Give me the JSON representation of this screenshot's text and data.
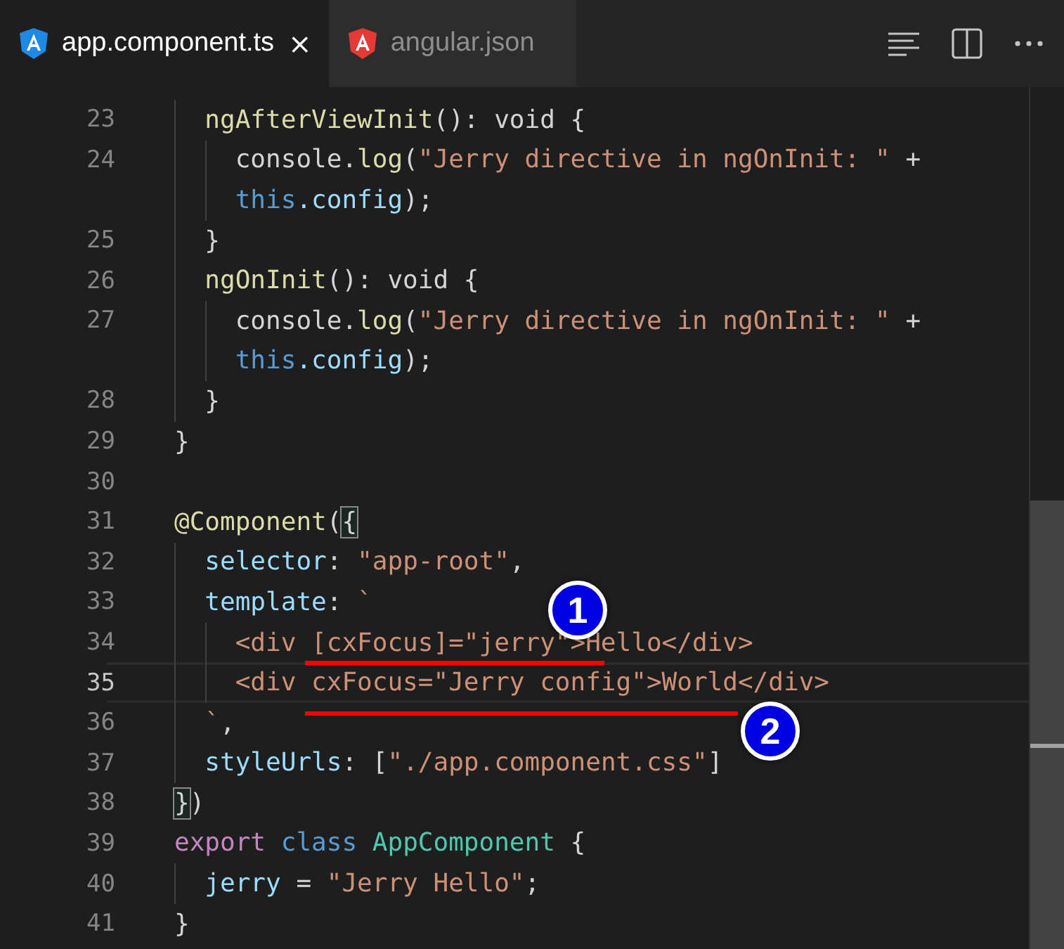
{
  "tabs": [
    {
      "label": "app.component.ts",
      "selected": true,
      "color": "#1e88e5",
      "close": "×"
    },
    {
      "label": "angular.json",
      "selected": false,
      "color": "#e53935"
    }
  ],
  "editor": {
    "lines": [
      {
        "number": "23",
        "current": false,
        "tokens": [
          {
            "t": "  ngAfterViewInit",
            "kind": "fn"
          },
          {
            "t": "(): void {",
            "kind": "plain"
          }
        ]
      },
      {
        "number": "24",
        "current": false,
        "tokens": [
          {
            "t": "    console.",
            "kind": "plain"
          },
          {
            "t": "log",
            "kind": "fn"
          },
          {
            "t": "(",
            "kind": "plain"
          },
          {
            "t": "\"Jerry directive in ngOnInit: \"",
            "kind": "str"
          },
          {
            "t": " +",
            "kind": "plain"
          }
        ]
      },
      {
        "current": false,
        "tokens": [
          {
            "t": "    this",
            "kind": "kw"
          },
          {
            "t": ".config",
            "kind": "prop"
          },
          {
            "t": ");",
            "kind": "plain"
          }
        ]
      },
      {
        "number": "25",
        "current": false,
        "tokens": [
          {
            "t": "  }",
            "kind": "plain"
          }
        ]
      },
      {
        "number": "26",
        "current": false,
        "tokens": [
          {
            "t": "  ngOnInit",
            "kind": "fn"
          },
          {
            "t": "(): void {",
            "kind": "plain"
          }
        ]
      },
      {
        "number": "27",
        "current": false,
        "tokens": [
          {
            "t": "    console.",
            "kind": "plain"
          },
          {
            "t": "log",
            "kind": "fn"
          },
          {
            "t": "(",
            "kind": "plain"
          },
          {
            "t": "\"Jerry directive in ngOnInit: \"",
            "kind": "str"
          },
          {
            "t": " +",
            "kind": "plain"
          }
        ]
      },
      {
        "current": false,
        "tokens": [
          {
            "t": "    this",
            "kind": "kw"
          },
          {
            "t": ".config",
            "kind": "prop"
          },
          {
            "t": ");",
            "kind": "plain"
          }
        ]
      },
      {
        "number": "28",
        "current": false,
        "tokens": [
          {
            "t": "  }",
            "kind": "plain"
          }
        ]
      },
      {
        "number": "29",
        "current": false,
        "tokens": [
          {
            "t": "}",
            "kind": "plain"
          }
        ]
      },
      {
        "number": "30",
        "current": false
      },
      {
        "number": "31",
        "current": false,
        "tokens": [
          {
            "t": "@Component",
            "kind": "deco"
          },
          {
            "t": "(",
            "kind": "plain"
          },
          {
            "t": "{",
            "kind": "plain",
            "bracket_match": true
          }
        ]
      },
      {
        "number": "32",
        "current": false,
        "tokens": [
          {
            "t": "  selector",
            "kind": "prop"
          },
          {
            "t": ": ",
            "kind": "plain"
          },
          {
            "t": "\"app-root\"",
            "kind": "str"
          },
          {
            "t": ",",
            "kind": "plain"
          }
        ]
      },
      {
        "number": "33",
        "current": false,
        "tokens": [
          {
            "t": "  template",
            "kind": "prop"
          },
          {
            "t": ": ",
            "kind": "plain"
          },
          {
            "t": "`",
            "kind": "str"
          }
        ]
      },
      {
        "number": "34",
        "current": false,
        "tokens": [
          {
            "t": "    <div [cxFocus]=\"jerry\">Hello</div>",
            "kind": "str"
          }
        ]
      },
      {
        "number": "35",
        "current": true,
        "tokens": [
          {
            "t": "    <div cxFocus=\"Jerry config\">World</div>",
            "kind": "str"
          }
        ]
      },
      {
        "number": "36",
        "current": false,
        "tokens": [
          {
            "t": "  `",
            "kind": "str"
          },
          {
            "t": ",",
            "kind": "plain"
          }
        ]
      },
      {
        "number": "37",
        "current": false,
        "tokens": [
          {
            "t": "  styleUrls",
            "kind": "prop"
          },
          {
            "t": ": [",
            "kind": "plain"
          },
          {
            "t": "\"./app.component.css\"",
            "kind": "str"
          },
          {
            "t": "]",
            "kind": "plain"
          }
        ]
      },
      {
        "number": "38",
        "current": false,
        "tokens": [
          {
            "t": "}",
            "kind": "plain",
            "bracket_match": true
          },
          {
            "t": ")",
            "kind": "plain"
          }
        ]
      },
      {
        "number": "39",
        "current": false,
        "tokens": [
          {
            "t": "export ",
            "kind": "ctrl"
          },
          {
            "t": "class ",
            "kind": "kw"
          },
          {
            "t": "AppComponent",
            "kind": "cls"
          },
          {
            "t": " {",
            "kind": "plain"
          }
        ]
      },
      {
        "number": "40",
        "current": false,
        "tokens": [
          {
            "t": "  jerry",
            "kind": "prop"
          },
          {
            "t": " = ",
            "kind": "plain"
          },
          {
            "t": "\"Jerry Hello\"",
            "kind": "str"
          },
          {
            "t": ";",
            "kind": "plain"
          }
        ]
      },
      {
        "number": "41",
        "current": false,
        "tokens": [
          {
            "t": "}",
            "kind": "plain"
          }
        ]
      }
    ]
  },
  "annotations": [
    {
      "label": "1"
    },
    {
      "label": "2"
    }
  ]
}
